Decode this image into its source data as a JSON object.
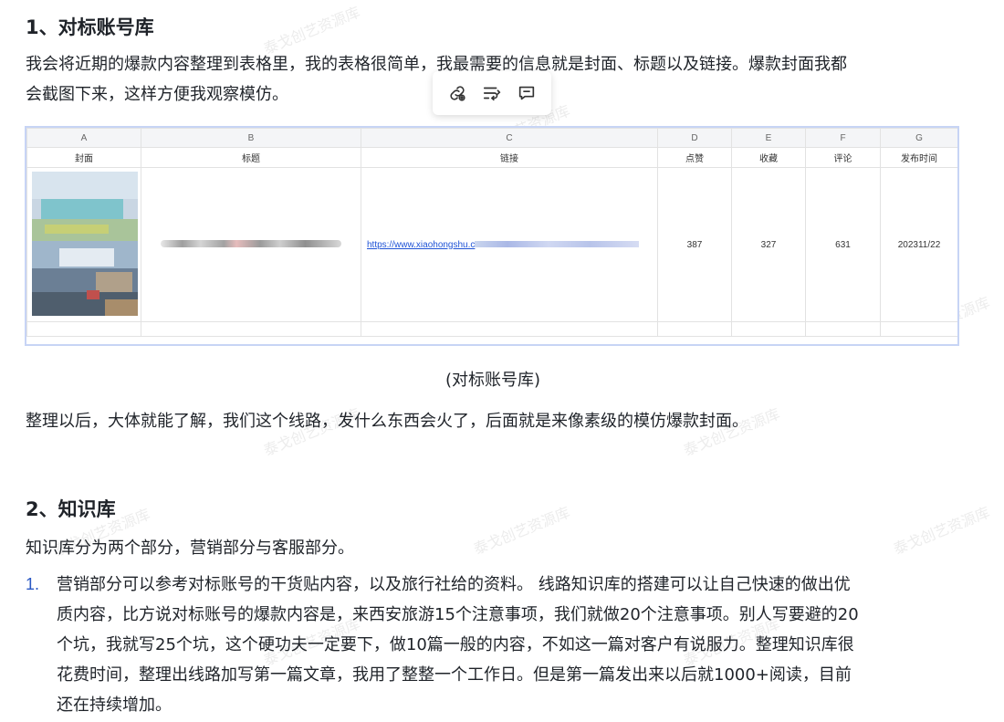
{
  "section1": {
    "heading": "1、对标账号库",
    "para_line1": "我会将近期的爆款内容整理到表格里，我的表格很简单，我最需要的信息就是封面、标题以及链接。爆款封面我都",
    "para_line2": "会截图下来，这样方便我观察模仿。"
  },
  "toolbar": {
    "icons": [
      "link-icon",
      "wrap-text-icon",
      "comment-icon"
    ]
  },
  "sheet": {
    "columns": [
      "A",
      "B",
      "C",
      "D",
      "E",
      "F",
      "G"
    ],
    "fields": [
      "封面",
      "标题",
      "链接",
      "点赞",
      "收藏",
      "评论",
      "发布时间"
    ],
    "row": {
      "link": "https://www.xiaohongshu.c",
      "likes": "387",
      "saves": "327",
      "comments": "631",
      "date": "202311/22"
    }
  },
  "caption": "(对标账号库)",
  "after_caption": "整理以后，大体就能了解，我们这个线路，发什么东西会火了，后面就是来像素级的模仿爆款封面。",
  "section2": {
    "heading": "2、知识库",
    "intro": "知识库分为两个部分，营销部分与客服部分。",
    "item_number": "1.",
    "item_lines": [
      "营销部分可以参考对标账号的干货贴内容，以及旅行社给的资料。 线路知识库的搭建可以让自己快速的做出优",
      "质内容，比方说对标账号的爆款内容是，来西安旅游15个注意事项，我们就做20个注意事项。别人写要避的20",
      "个坑，我就写25个坑，这个硬功夫一定要下，做10篇一般的内容，不如这一篇对客户有说服力。整理知识库很",
      "花费时间，整理出线路加写第一篇文章，我用了整整一个工作日。但是第一篇发出来以后就1000+阅读，目前",
      "还在持续增加。"
    ]
  },
  "watermark": "泰戈创艺资源库"
}
